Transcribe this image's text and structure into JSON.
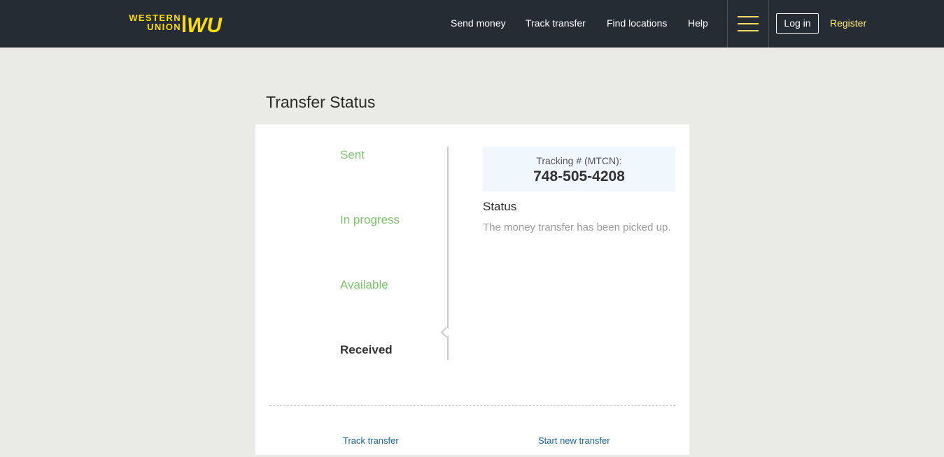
{
  "brand": {
    "logo_line1": "WESTERN",
    "logo_line2": "UNION",
    "logo_mark": "WU",
    "accent_color": "#ffdd00"
  },
  "nav": {
    "links": [
      "Send money",
      "Track transfer",
      "Find locations",
      "Help"
    ],
    "menu_icon": "hamburger-icon",
    "login_label": "Log in",
    "register_label": "Register"
  },
  "page": {
    "title": "Transfer Status"
  },
  "progress": {
    "steps": [
      "Sent",
      "In progress",
      "Available",
      "Received"
    ],
    "current_step": "Received",
    "completed_color": "#7dc36c"
  },
  "tracking": {
    "label": "Tracking # (MTCN):",
    "number": "748-505-4208"
  },
  "status": {
    "heading": "Status",
    "message": "The money transfer has been picked up."
  },
  "actions": {
    "track_label": "Track transfer",
    "new_transfer_label": "Start new transfer"
  }
}
